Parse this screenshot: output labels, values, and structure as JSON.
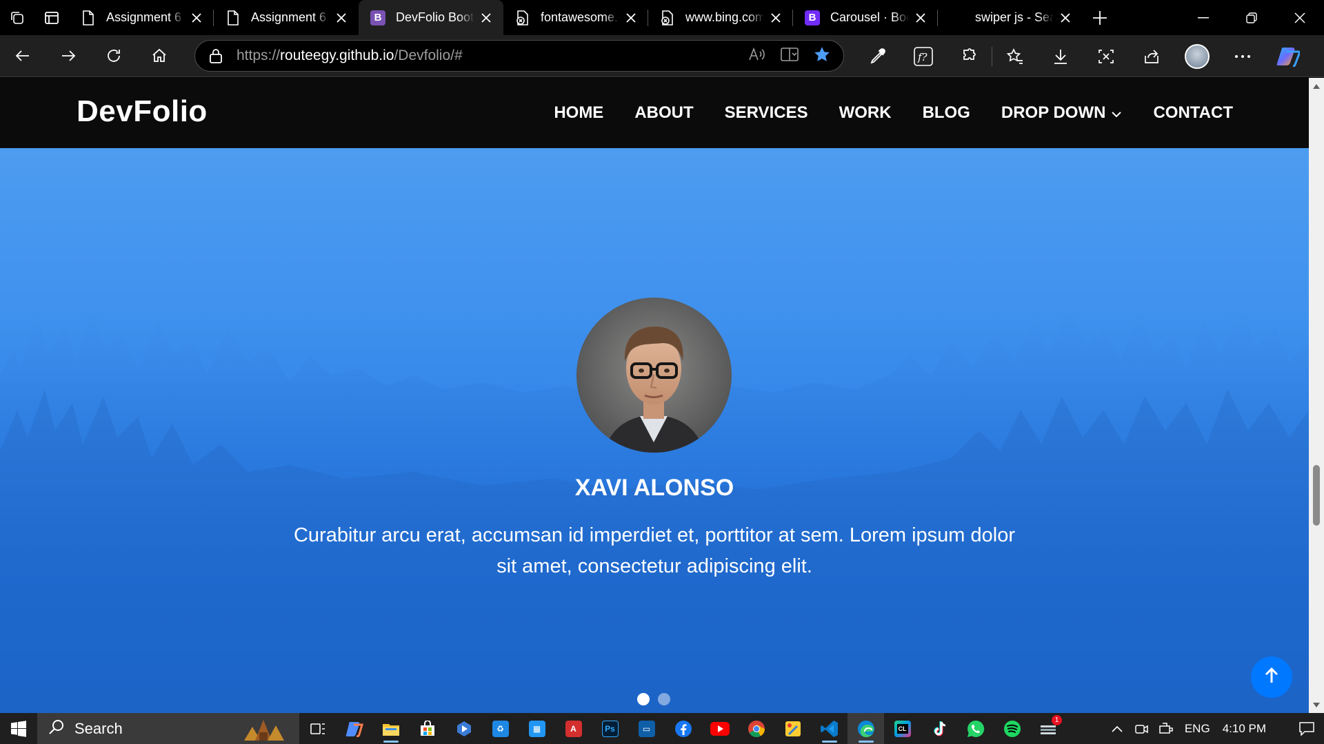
{
  "browser": {
    "tabs": [
      {
        "label": "Assignment 6",
        "icon": "page-icon",
        "active": false
      },
      {
        "label": "Assignment 6",
        "icon": "page-icon",
        "active": false
      },
      {
        "label": "DevFolio Bootstrap",
        "icon": "bootstrap-icon",
        "active": true
      },
      {
        "label": "fontawesome.com",
        "icon": "broken-page-icon",
        "active": false
      },
      {
        "label": "www.bing.com",
        "icon": "broken-page-icon",
        "active": false
      },
      {
        "label": "Carousel · Bootstrap",
        "icon": "bootstrap-icon",
        "active": false
      },
      {
        "label": "swiper js - Search",
        "icon": "search-icon",
        "active": false
      }
    ],
    "bootstrap_icon_letter": "B",
    "address": {
      "scheme": "https://",
      "host": "routeegy.github.io",
      "path": "/Devfolio/#"
    }
  },
  "site": {
    "brand": "DevFolio",
    "menu": [
      "HOME",
      "ABOUT",
      "SERVICES",
      "WORK",
      "BLOG",
      "DROP DOWN",
      "CONTACT"
    ],
    "testimonial": {
      "name": "XAVI ALONSO",
      "quote": "Curabitur arcu erat, accumsan id imperdiet et, porttitor at sem. Lorem ipsum dolor sit amet, consectetur adipiscing elit.",
      "slide_count": 2,
      "active_slide": 1
    },
    "colors": {
      "nav": "#0b0b0b",
      "hero_blue": "#2f86e6",
      "to_top": "#0078ff"
    }
  },
  "taskbar": {
    "search_label": "Search",
    "language": "ENG",
    "time": "4:10 PM",
    "notification_count": "1",
    "app_icons": [
      "task-view-icon",
      "copilot-icon",
      "file-explorer-icon",
      "store-icon",
      "media-player-icon",
      "recycle-app-icon",
      "photo-app-icon",
      "acrobat-icon",
      "photoshop-icon",
      "app-window-icon",
      "facebook-icon",
      "youtube-icon",
      "chrome-icon",
      "paint-icon",
      "vscode-icon",
      "edge-icon",
      "clion-icon",
      "tiktok-icon",
      "whatsapp-icon",
      "spotify-icon",
      "updates-icon"
    ]
  }
}
